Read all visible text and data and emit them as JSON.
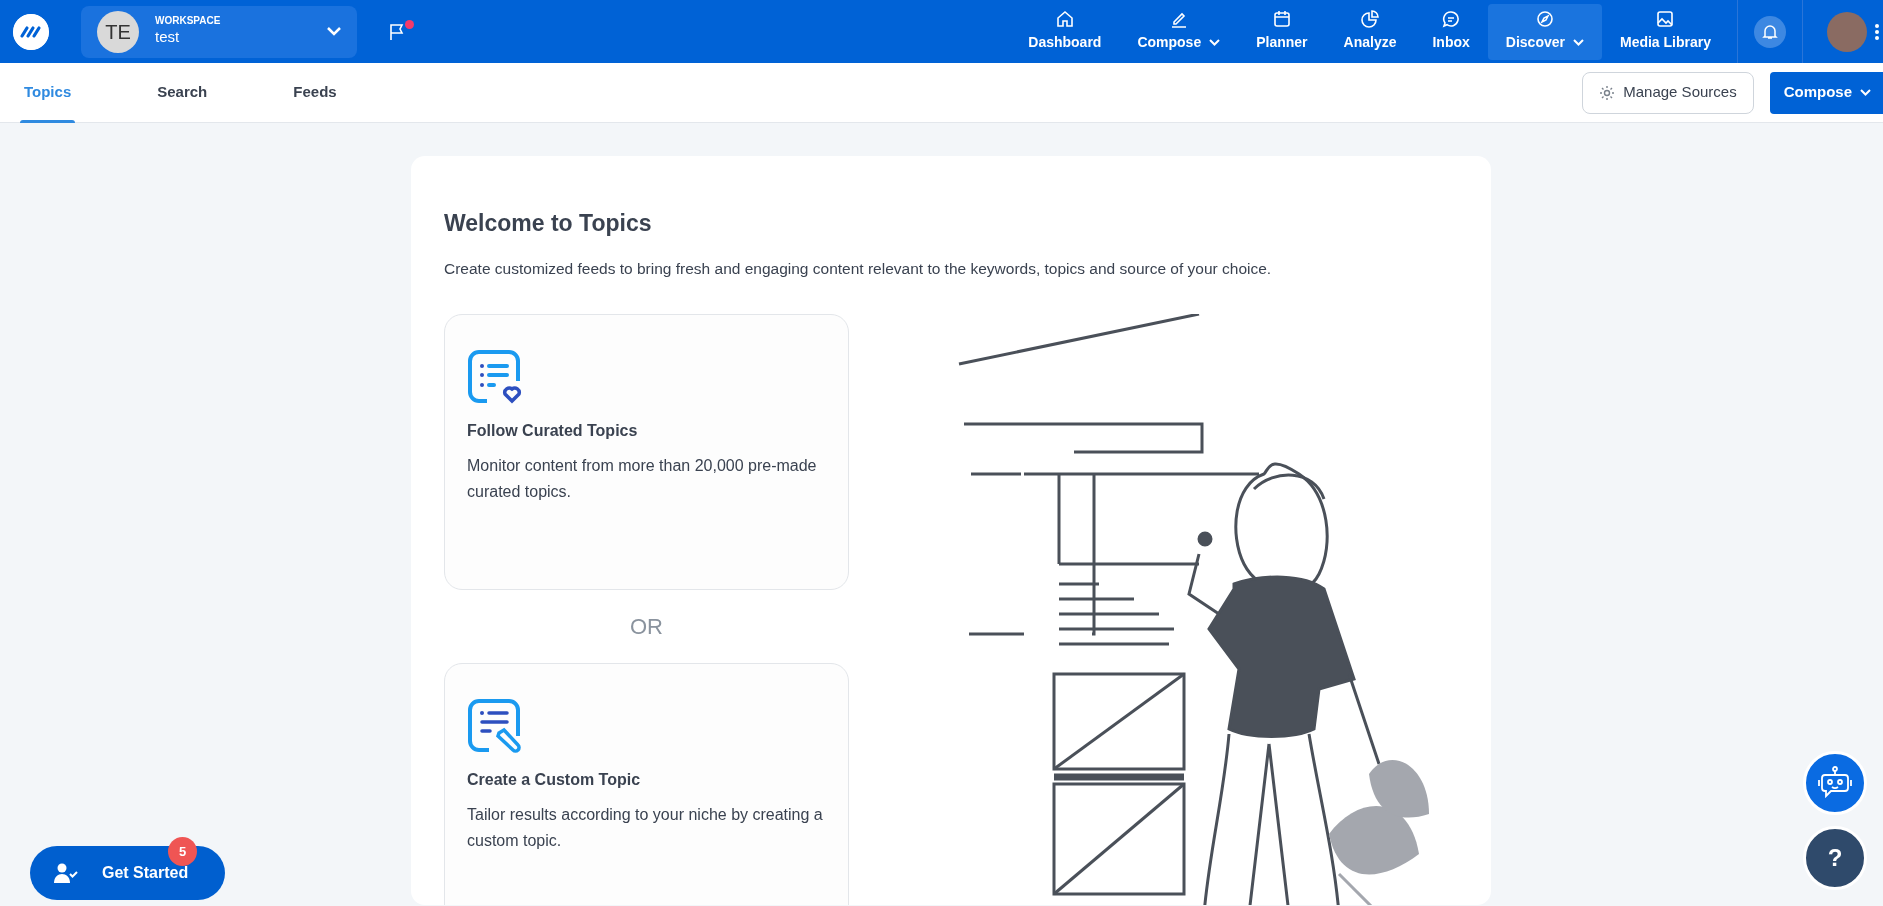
{
  "workspace": {
    "initials": "TE",
    "label": "WORKSPACE",
    "name": "test"
  },
  "notification_dot": true,
  "nav": [
    {
      "label": "Dashboard",
      "dropdown": false,
      "selected": false
    },
    {
      "label": "Compose",
      "dropdown": true,
      "selected": false
    },
    {
      "label": "Planner",
      "dropdown": false,
      "selected": false
    },
    {
      "label": "Analyze",
      "dropdown": false,
      "selected": false
    },
    {
      "label": "Inbox",
      "dropdown": false,
      "selected": false
    },
    {
      "label": "Discover",
      "dropdown": true,
      "selected": true
    },
    {
      "label": "Media Library",
      "dropdown": false,
      "selected": false
    }
  ],
  "tabs": [
    {
      "label": "Topics",
      "selected": true
    },
    {
      "label": "Search",
      "selected": false
    },
    {
      "label": "Feeds",
      "selected": false
    }
  ],
  "manage_sources": "Manage Sources",
  "compose_button": "Compose",
  "welcome": {
    "title": "Welcome to Topics",
    "description": "Create customized feeds to bring fresh and engaging content relevant to the keywords, topics and source of your choice."
  },
  "options": [
    {
      "kind": "curated",
      "title": "Follow Curated Topics",
      "description": "Monitor content from more than 20,000 pre-made curated topics."
    },
    {
      "kind": "custom",
      "title": "Create a Custom Topic",
      "description": "Tailor results according to your niche by creating a custom topic."
    }
  ],
  "separator": "OR",
  "get_started": {
    "label": "Get Started",
    "count": "5"
  },
  "help": "?"
}
